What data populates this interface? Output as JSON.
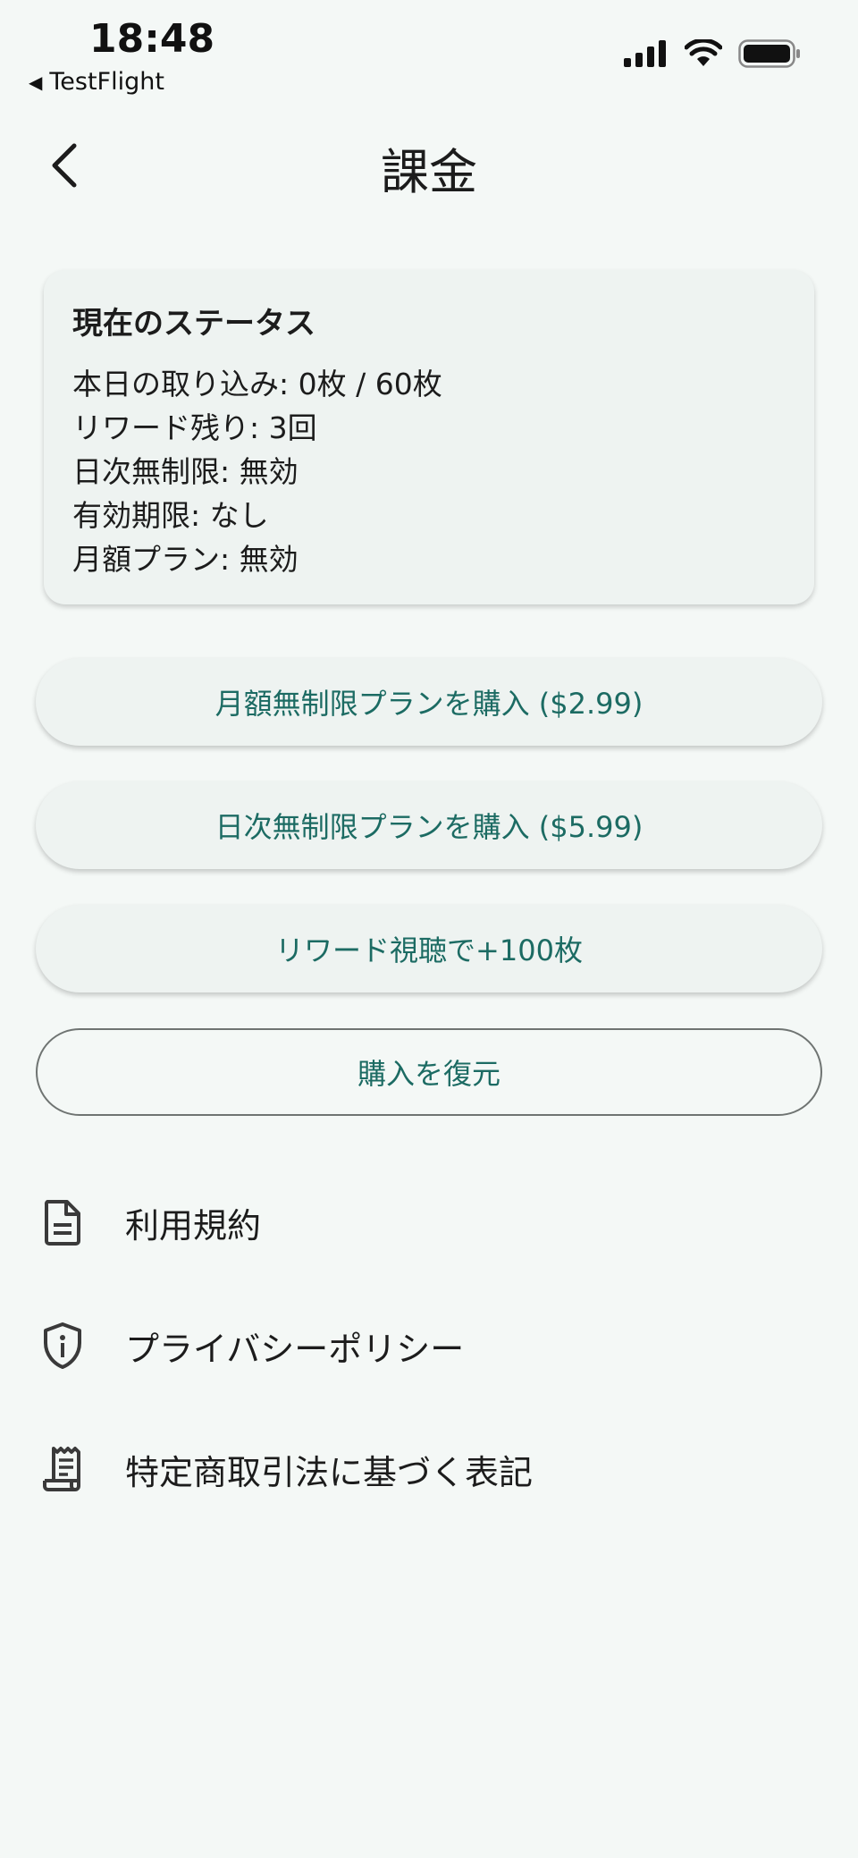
{
  "status_bar": {
    "time": "18:48",
    "back_app": "TestFlight",
    "icons": [
      "cellular-signal-icon",
      "wifi-icon",
      "battery-icon"
    ]
  },
  "header": {
    "title": "課金",
    "back_icon": "chevron-left-icon"
  },
  "status_card": {
    "title": "現在のステータス",
    "lines": [
      "本日の取り込み: 0枚 / 60枚",
      "リワード残り: 3回",
      "日次無制限: 無効",
      "有効期限: なし",
      "月額プラン: 無効"
    ]
  },
  "buttons": {
    "monthly": "月額無制限プランを購入 ($2.99)",
    "daily": "日次無制限プランを購入 ($5.99)",
    "reward": "リワード視聴で+100枚",
    "restore": "購入を復元"
  },
  "links": [
    {
      "label": "利用規約",
      "icon": "document-icon"
    },
    {
      "label": "プライバシーポリシー",
      "icon": "shield-info-icon"
    },
    {
      "label": "特定商取引法に基づく表記",
      "icon": "receipt-icon"
    }
  ],
  "colors": {
    "background": "#f4f8f6",
    "card": "#eef3f1",
    "accent_text": "#1c6b63",
    "outline": "#6f7472"
  }
}
